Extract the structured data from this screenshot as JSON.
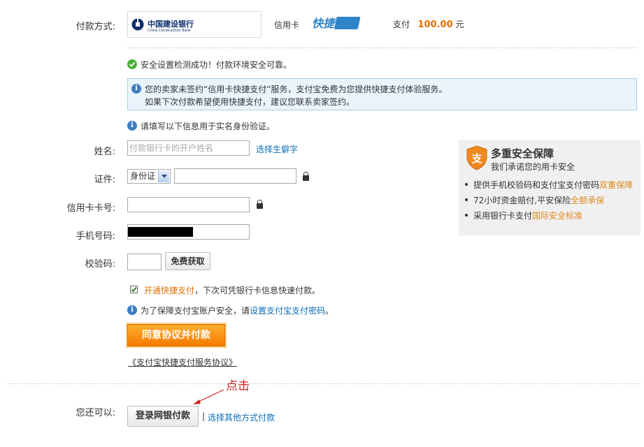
{
  "payment": {
    "label": "付款方式:",
    "bank_cn": "中国建设银行",
    "bank_en": "China Construction Bank",
    "card_type": "信用卡",
    "kuaijie": "快捷支付",
    "pay_label": "支付",
    "amount": "100.00",
    "unit": "元"
  },
  "security_ok": "安全设置检测成功！付款环境安全可靠。",
  "notice": {
    "line1": "您的卖家未签约“信用卡快捷支付”服务，支付宝免费为您提供快捷支付体验服务。",
    "line2": "如果下次付款希望使用快捷支付，建议您联系卖家签约。"
  },
  "fill_hint": "请填写以下信息用于实名身份验证。",
  "form": {
    "name_label": "姓名:",
    "name_placeholder": "付款银行卡的开户姓名",
    "rare_char_link": "选择生僻字",
    "id_label": "证件:",
    "id_type": "身份证",
    "card_label": "信用卡卡号:",
    "phone_label": "手机号码:",
    "code_label": "校验码:",
    "get_code_btn": "免费获取"
  },
  "quickpay": {
    "link": "开通快捷支付",
    "text": "，下次可凭银行卡信息快速付款。"
  },
  "pwd_hint": {
    "text": "为了保障支付宝账户安全，请",
    "link": "设置支付宝支付密码",
    "end": "。"
  },
  "agree_btn": "同意协议并付款",
  "agreement_link": "《支付宝快捷支付服务协议》",
  "side": {
    "title": "多重安全保障",
    "subtitle": "我们承诺您的用卡安全",
    "items": [
      {
        "text": "提供手机校验码和支付宝支付密码",
        "hl": "双重保障"
      },
      {
        "text": "72小时资金赔付,平安保险",
        "hl": "全额承保"
      },
      {
        "text": "采用银行卡支付",
        "hl": "国际安全标准"
      }
    ],
    "shield_char": "支"
  },
  "annotation": "点击",
  "other": {
    "label": "您还可以:",
    "netbank_btn": "登录网银付款",
    "sep": "|",
    "other_link": "选择其他方式付款"
  },
  "colors": {
    "accent": "#f57a00",
    "link": "#0b6cb7",
    "highlight": "#e08a1e"
  }
}
